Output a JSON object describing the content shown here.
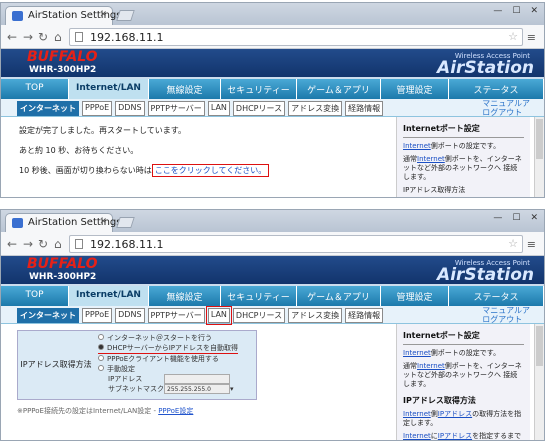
{
  "browser": {
    "tab_title": "AirStation Settings",
    "url": "192.168.11.1"
  },
  "header": {
    "brand": "BUFFALO",
    "model": "WHR-300HP2",
    "subtitle": "Wireless Access Point",
    "product": "AirStation"
  },
  "tabs": [
    "TOP",
    "Internet/LAN",
    "無線設定",
    "セキュリティー",
    "ゲーム＆アプリ",
    "管理設定",
    "ステータス"
  ],
  "subtabs": [
    "インターネット",
    "PPPoE",
    "DDNS",
    "PPTPサーバー",
    "LAN",
    "DHCPリース",
    "アドレス変換",
    "経路情報"
  ],
  "manual": {
    "line1": "マニュアルア",
    "line2": "ログアウト"
  },
  "screen1": {
    "msg1": "設定が完了しました。再スタートしています。",
    "msg2": "あと約 10 秒、お待ちください。",
    "msg3_pre": "10 秒後、画面が切り換わらない時は",
    "msg3_link": "ここをクリックしてください。",
    "side": {
      "title": "Internetポート設定",
      "p1_link": "Internet",
      "p1": "側ポートの設定です。",
      "p2_pre": "通常",
      "p2_link": "Internet",
      "p2": "側ポートを、インターネットなど外部のネットワークへ 接続します。",
      "p3": "IPアドレス取得方法"
    }
  },
  "screen2": {
    "label": "IPアドレス取得方法",
    "options": [
      "インターネット＠スタートを行う",
      "DHCPサーバーからIPアドレスを自動取得",
      "PPPoEクライアント機能を使用する",
      "手動設定"
    ],
    "ip_label": "IPアドレス",
    "mask_label": "サブネットマスク",
    "mask_value": "255.255.255.0",
    "note_pre": "※PPPoE接続先の設定はInternet/LAN設定 - ",
    "note_link": "PPPoE設定",
    "side": {
      "title": "Internetポート設定",
      "p1_link": "Internet",
      "p1": "側ポートの設定です。",
      "p2_pre": "通常",
      "p2_link": "Internet",
      "p2": "側ポートを、インターネットなど外部のネットワークへ 接続します。",
      "t2": "IPアドレス取得方法",
      "p3_link1": "Internet",
      "p3_mid": "側",
      "p3_link2": "IPアドレス",
      "p3": "の取得方法を指定します。",
      "p4_link1": "Internet",
      "p4_mid": "に",
      "p4_link2": "IPアドレス",
      "p4": "を指定するまでは外部のネットワーク"
    }
  },
  "colors": {
    "accent": "#1f6fa8",
    "brand": "#e62117",
    "highlight": "#d11111"
  }
}
